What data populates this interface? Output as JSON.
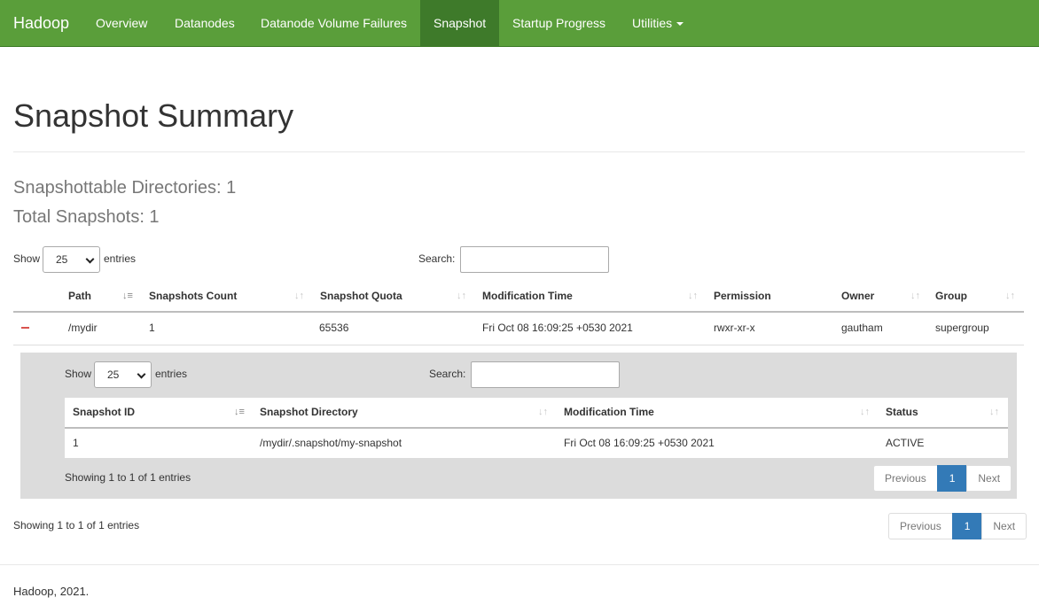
{
  "nav": {
    "brand": "Hadoop",
    "items": [
      {
        "label": "Overview"
      },
      {
        "label": "Datanodes"
      },
      {
        "label": "Datanode Volume Failures"
      },
      {
        "label": "Snapshot"
      },
      {
        "label": "Startup Progress"
      },
      {
        "label": "Utilities"
      }
    ],
    "active_item": "Snapshot",
    "accent_color": "#5a9e3a",
    "active_color": "#3e7a2a"
  },
  "page": {
    "title": "Snapshot Summary",
    "snapshottable_dirs": "Snapshottable Directories: 1",
    "total_snapshots": "Total Snapshots: 1"
  },
  "outer_table": {
    "show_label": "Show",
    "page_size": "25",
    "entries_label": "entries",
    "search_label": "Search:",
    "search_value": "",
    "columns": [
      "Path",
      "Snapshots Count",
      "Snapshot Quota",
      "Modification Time",
      "Permission",
      "Owner",
      "Group"
    ],
    "sorted_column": "Path",
    "rows": [
      {
        "expand_icon": "minus-icon",
        "path": "/mydir",
        "snapshots_count": "1",
        "snapshot_quota": "65536",
        "modification_time": "Fri Oct 08 16:09:25 +0530 2021",
        "permission": "rwxr-xr-x",
        "owner": "gautham",
        "group": "supergroup"
      }
    ],
    "info": "Showing 1 to 1 of 1 entries",
    "pagination": {
      "previous": "Previous",
      "current": "1",
      "next": "Next"
    }
  },
  "inner_table": {
    "show_label": "Show",
    "page_size": "25",
    "entries_label": "entries",
    "search_label": "Search:",
    "search_value": "",
    "columns": [
      "Snapshot ID",
      "Snapshot Directory",
      "Modification Time",
      "Status"
    ],
    "sorted_column": "Snapshot ID",
    "rows": [
      {
        "id": "1",
        "directory": "/mydir/.snapshot/my-snapshot",
        "modification_time": "Fri Oct 08 16:09:25 +0530 2021",
        "status": "ACTIVE"
      }
    ],
    "info": "Showing 1 to 1 of 1 entries",
    "pagination": {
      "previous": "Previous",
      "current": "1",
      "next": "Next"
    }
  },
  "footer": {
    "text": "Hadoop, 2021."
  },
  "colors": {
    "pager_active": "#337ab7",
    "collapse_icon": "#d9534f",
    "child_bg": "#dcdcdc"
  }
}
